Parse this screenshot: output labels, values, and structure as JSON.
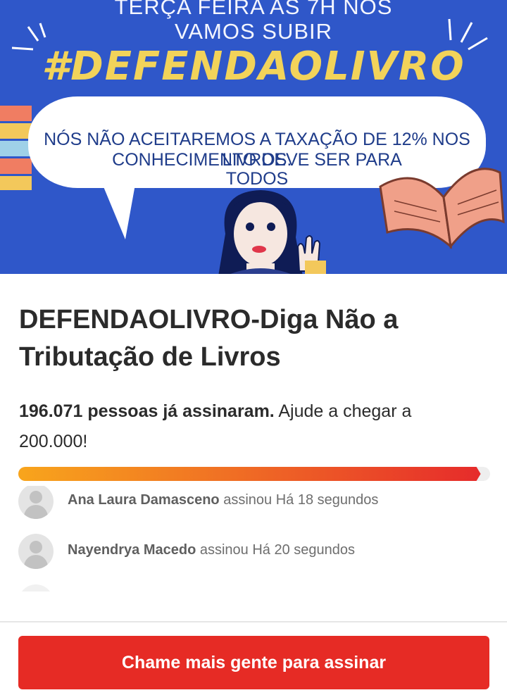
{
  "banner": {
    "line1": "TERÇA FEIRA AS 7H  NOS",
    "line2": "VAMOS SUBIR",
    "hashtag": "#DEFENDAOLIVRO",
    "bubble_line1": "NÓS NÃO ACEITAREMOS A TAXAÇÃO DE 12% NOS LIVROS.",
    "bubble_line2": "CONHECIMENTO DEVE SER PARA",
    "bubble_line3": "TODOS",
    "colors": {
      "background": "#2f57c9",
      "hashtag": "#f2d35a",
      "bubble_text": "#1f3c8a"
    }
  },
  "petition": {
    "title": "DEFENDAOLIVRO-Diga Não a Tributação de Livros",
    "signed_count_text": "196.071 pessoas já assinaram.",
    "goal_text": "Ajude a chegar a 200.000!",
    "progress_fraction": 0.98
  },
  "signers": [
    {
      "name": "Ana Laura Damasceno",
      "action": "assinou",
      "time": "Há 18 segundos"
    },
    {
      "name": "Nayendrya Macedo",
      "action": "assinou",
      "time": "Há 20 segundos"
    }
  ],
  "cta": {
    "label": "Chame mais gente para assinar",
    "color": "#e62b25"
  }
}
